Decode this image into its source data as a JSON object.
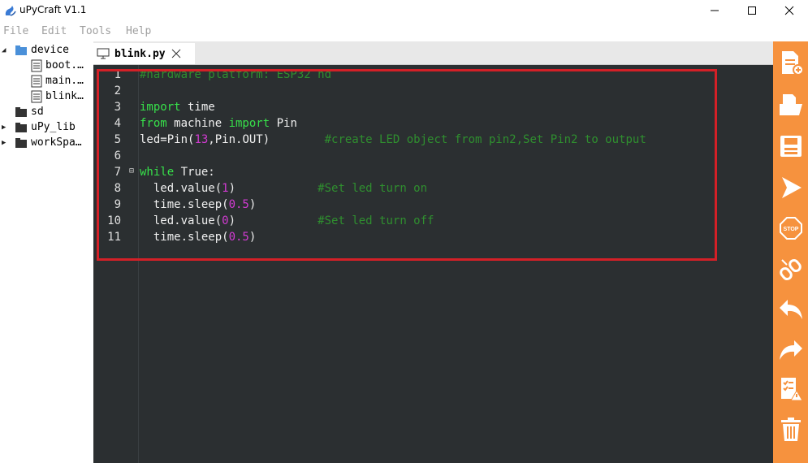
{
  "window": {
    "title": "uPyCraft V1.1"
  },
  "menu": {
    "items": [
      "File",
      "Edit",
      "Tools",
      "Help"
    ]
  },
  "tree": {
    "items": [
      {
        "label": "device",
        "icon": "folder-icon"
      },
      {
        "label": "boot.…",
        "icon": "file-icon"
      },
      {
        "label": "main.…",
        "icon": "file-icon"
      },
      {
        "label": "blink…",
        "icon": "file-icon"
      },
      {
        "label": "sd",
        "icon": "folder-icon"
      },
      {
        "label": "uPy_lib",
        "icon": "folder-icon"
      },
      {
        "label": "workSpa…",
        "icon": "folder-icon"
      }
    ]
  },
  "tab": {
    "label": "blink.py"
  },
  "editor": {
    "line_numbers": [
      "1",
      "2",
      "3",
      "4",
      "5",
      "6",
      "7",
      "8",
      "9",
      "10",
      "11"
    ],
    "lines": [
      [
        {
          "t": "#hardware platform: ESP32 nd",
          "c": "cm"
        }
      ],
      [],
      [
        {
          "t": "import",
          "c": "kw"
        },
        {
          "t": " time",
          "c": ""
        }
      ],
      [
        {
          "t": "from",
          "c": "kw"
        },
        {
          "t": " machine ",
          "c": ""
        },
        {
          "t": "import",
          "c": "kw"
        },
        {
          "t": " Pin",
          "c": ""
        }
      ],
      [
        {
          "t": "led=Pin(",
          "c": ""
        },
        {
          "t": "13",
          "c": "num"
        },
        {
          "t": ",Pin.OUT)        ",
          "c": ""
        },
        {
          "t": "#create LED object from pin2,Set Pin2 to output",
          "c": "cm"
        }
      ],
      [],
      [
        {
          "t": "while",
          "c": "kw"
        },
        {
          "t": " True:",
          "c": ""
        }
      ],
      [
        {
          "t": "  led.value(",
          "c": ""
        },
        {
          "t": "1",
          "c": "num"
        },
        {
          "t": ")            ",
          "c": ""
        },
        {
          "t": "#Set led turn on",
          "c": "cm"
        }
      ],
      [
        {
          "t": "  time.sleep(",
          "c": ""
        },
        {
          "t": "0.5",
          "c": "num"
        },
        {
          "t": ")",
          "c": ""
        }
      ],
      [
        {
          "t": "  led.value(",
          "c": ""
        },
        {
          "t": "0",
          "c": "num"
        },
        {
          "t": ")            ",
          "c": ""
        },
        {
          "t": "#Set led turn off",
          "c": "cm"
        }
      ],
      [
        {
          "t": "  time.sleep(",
          "c": ""
        },
        {
          "t": "0.5",
          "c": "num"
        },
        {
          "t": ")",
          "c": ""
        }
      ]
    ]
  },
  "toolbar": {
    "buttons": [
      "new-file-icon",
      "open-file-icon",
      "save-icon",
      "run-icon",
      "stop-icon",
      "connect-icon",
      "undo-icon",
      "redo-icon",
      "syntax-check-icon",
      "clear-icon"
    ]
  },
  "colors": {
    "accent": "#f6923e",
    "editor_bg": "#2b2f31",
    "keyword": "#37e04a",
    "number": "#d23bd2",
    "comment": "#2f8f2f",
    "highlight": "#d42027"
  }
}
